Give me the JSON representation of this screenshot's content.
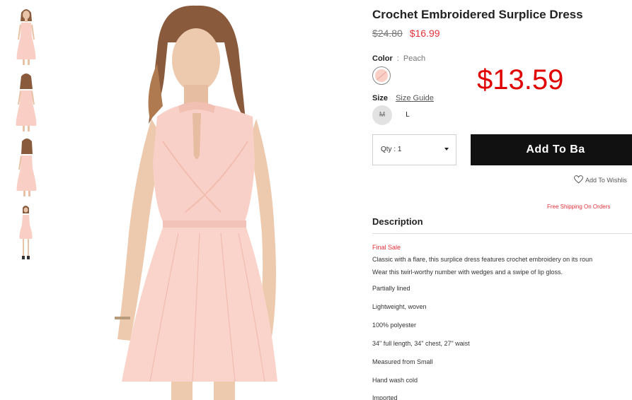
{
  "thumbnails": [
    {
      "alt": "front view"
    },
    {
      "alt": "back view"
    },
    {
      "alt": "side back view"
    },
    {
      "alt": "full length view"
    }
  ],
  "product": {
    "title": "Crochet Embroidered Surplice Dress",
    "price_original": "$24.80",
    "price_sale": "$16.99",
    "overlay_price": "$13.59"
  },
  "color": {
    "label": "Color",
    "separator": ":",
    "value": "Peach",
    "swatch_color": "#f9cfc6"
  },
  "size": {
    "label": "Size",
    "guide_label": "Size Guide",
    "options": [
      "M",
      "L"
    ]
  },
  "quantity": {
    "label": "Qty : 1"
  },
  "add_to_bag": {
    "label": "Add To Ba"
  },
  "wishlist": {
    "label": "Add To Wishlis"
  },
  "shipping": {
    "text": "Free Shipping On Orders"
  },
  "description": {
    "heading": "Description",
    "final_sale": "Final Sale",
    "lines": [
      "Classic with a flare, this surplice dress features crochet embroidery on its roun",
      "Wear this twirl-worthy number with wedges and a swipe of lip gloss.",
      "Partially lined",
      "Lightweight, woven",
      "100% polyester",
      "34\" full length, 34\" chest, 27\" waist",
      "Measured from Small",
      "Hand wash cold",
      "Imported"
    ]
  },
  "colors": {
    "sale_red": "#e2333a",
    "overlay_red": "#e00000",
    "button_black": "#111111",
    "dress_peach": "#f9cfc6"
  }
}
